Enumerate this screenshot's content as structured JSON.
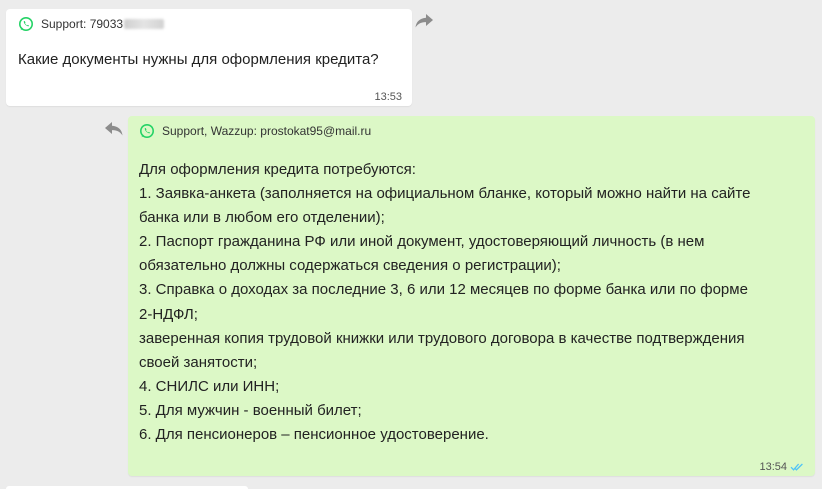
{
  "messages": {
    "incoming": {
      "sender": "Support: 79033",
      "text": "Какие документы нужны для оформления кредита?",
      "time": "13:53"
    },
    "outgoing": {
      "sender": "Support, Wazzup: prostokat95@mail.ru",
      "lines": [
        "Для оформления кредита потребуются:",
        "1. Заявка-анкета (заполняется на официальном бланке, который можно найти на сайте",
        "банка или в любом его отделении);",
        "2. Паспорт гражданина РФ или иной документ, удостоверяющий личность (в нем",
        "обязательно должны содержаться сведения о регистрации);",
        "3. Справка о доходах за последние 3, 6 или 12 месяцев по форме банка или по форме",
        "2-НДФЛ;",
        "заверенная копия трудовой книжки или трудового договора в качестве подтверждения",
        "своей занятости;",
        "4. СНИЛС или ИНН;",
        "5. Для мужчин - военный билет;",
        "6. Для пенсионеров – пенсионное удостоверение."
      ],
      "time": "13:54",
      "status": "read"
    }
  },
  "icons": {
    "channel": "whatsapp-icon",
    "forward": "forward-icon",
    "reply": "reply-icon",
    "read_status": "double-check-icon"
  },
  "colors": {
    "background": "#ececec",
    "incoming_bubble": "#ffffff",
    "outgoing_bubble": "#dcf8c6",
    "whatsapp_green": "#25d366",
    "action_icon": "#8c8c8c"
  }
}
